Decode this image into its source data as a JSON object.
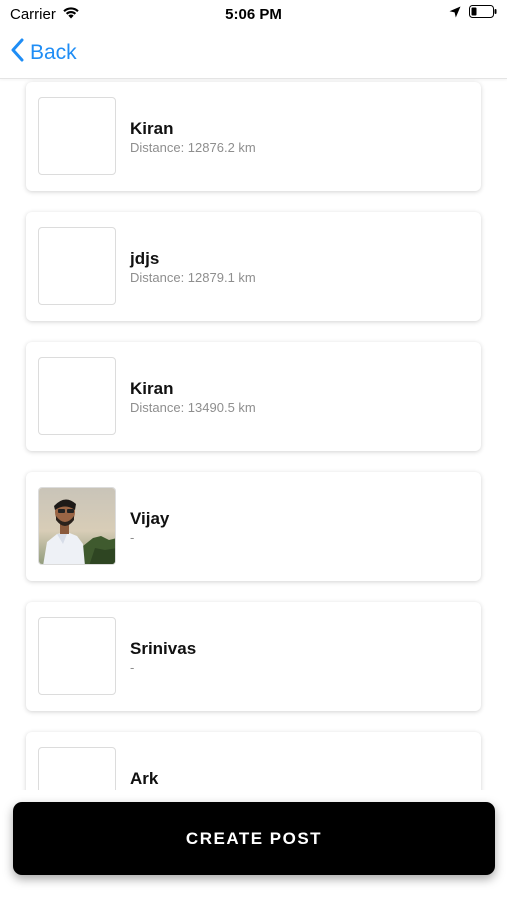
{
  "status_bar": {
    "carrier": "Carrier",
    "time": "5:06 PM",
    "icons": [
      "wifi-icon",
      "location-arrow-icon",
      "battery-icon"
    ]
  },
  "nav": {
    "back_label": "Back",
    "accent_color": "#1f8df5"
  },
  "list": {
    "items": [
      {
        "name": "Kiran",
        "distance": "Distance: 12876.2 km",
        "has_photo": false
      },
      {
        "name": "jdjs",
        "distance": "Distance: 12879.1 km",
        "has_photo": false
      },
      {
        "name": "Kiran",
        "distance": "Distance: 13490.5 km",
        "has_photo": false
      },
      {
        "name": "Vijay",
        "distance": "-",
        "has_photo": true
      },
      {
        "name": "Srinivas",
        "distance": "-",
        "has_photo": false
      },
      {
        "name": "Ark",
        "distance": "",
        "has_photo": false
      }
    ]
  },
  "actions": {
    "create_post_label": "CREATE POST"
  }
}
